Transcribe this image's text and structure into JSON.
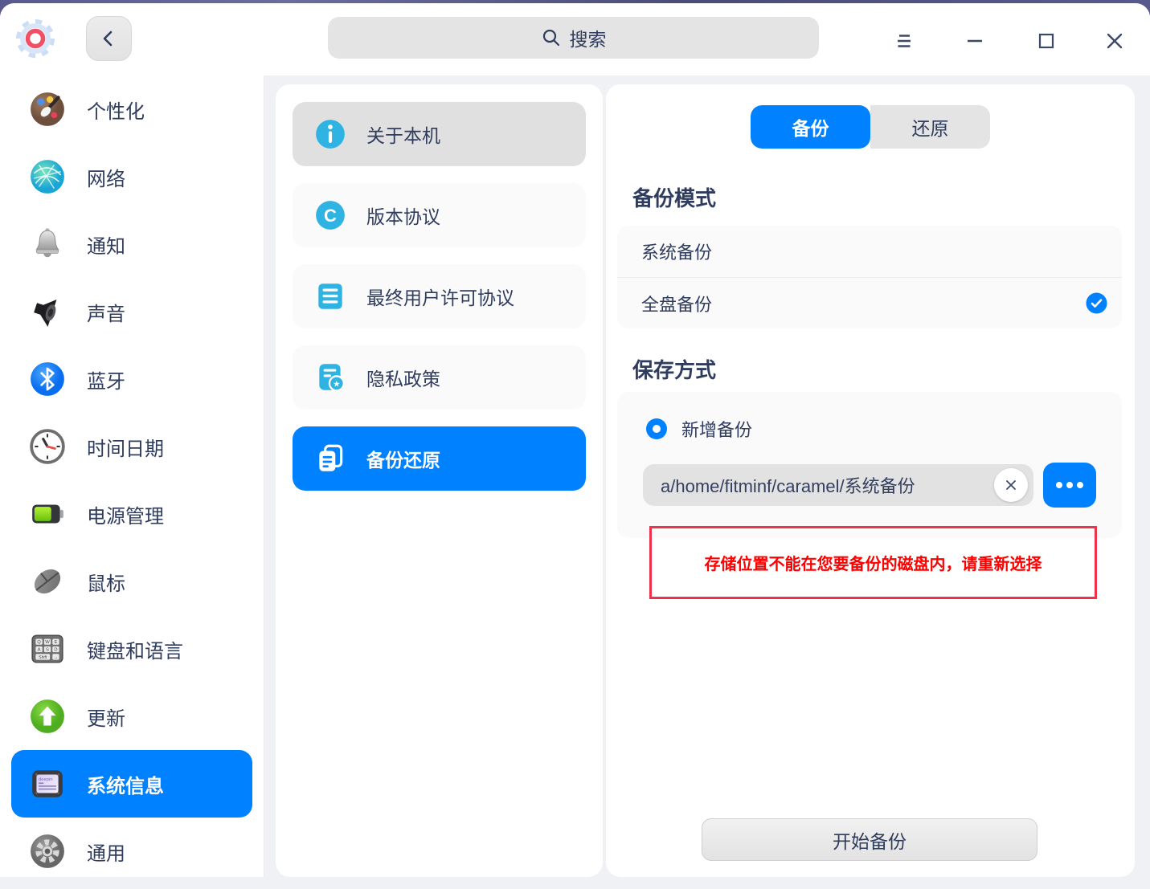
{
  "titlebar": {
    "search_placeholder": "搜索",
    "icons": [
      "app-gear-logo",
      "back-chevron",
      "search-magnifier",
      "hamburger-menu",
      "minimize",
      "maximize",
      "close"
    ]
  },
  "sidebar": {
    "items": [
      {
        "label": "个性化",
        "icon": "palette-icon",
        "selected": false
      },
      {
        "label": "网络",
        "icon": "network-globe-icon",
        "selected": false
      },
      {
        "label": "通知",
        "icon": "bell-icon",
        "selected": false
      },
      {
        "label": "声音",
        "icon": "speaker-icon",
        "selected": false
      },
      {
        "label": "蓝牙",
        "icon": "bluetooth-icon",
        "selected": false
      },
      {
        "label": "时间日期",
        "icon": "clock-icon",
        "selected": false
      },
      {
        "label": "电源管理",
        "icon": "battery-icon",
        "selected": false
      },
      {
        "label": "鼠标",
        "icon": "mouse-icon",
        "selected": false
      },
      {
        "label": "键盘和语言",
        "icon": "keyboard-icon",
        "selected": false
      },
      {
        "label": "更新",
        "icon": "update-arrow-icon",
        "selected": false
      },
      {
        "label": "系统信息",
        "icon": "deepin-chip-icon",
        "selected": true
      },
      {
        "label": "通用",
        "icon": "gear-icon",
        "selected": false
      }
    ]
  },
  "system_menu": {
    "items": [
      {
        "label": "关于本机",
        "icon": "info-icon",
        "state": "hovered"
      },
      {
        "label": "版本协议",
        "icon": "copyright-icon",
        "state": "normal"
      },
      {
        "label": "最终用户许可协议",
        "icon": "document-icon",
        "state": "normal"
      },
      {
        "label": "隐私政策",
        "icon": "privacy-star-doc-icon",
        "state": "normal"
      },
      {
        "label": "备份还原",
        "icon": "backup-docs-icon",
        "state": "selected"
      }
    ]
  },
  "backup_panel": {
    "tabs": [
      {
        "label": "备份",
        "active": true
      },
      {
        "label": "还原",
        "active": false
      }
    ],
    "mode_section": {
      "title": "备份模式",
      "options": [
        {
          "label": "系统备份",
          "checked": false
        },
        {
          "label": "全盘备份",
          "checked": true
        }
      ]
    },
    "save_section": {
      "title": "保存方式",
      "option_label": "新增备份",
      "path_value": "a/home/fitminf/caramel/系统备份"
    },
    "error_message": "存储位置不能在您要备份的磁盘内，请重新选择",
    "start_button_label": "开始备份"
  },
  "colors": {
    "accent": "#0081ff",
    "list_icon_cyan": "#2eb3e2",
    "error_text": "#fe0000",
    "error_border": "#f0314b",
    "text": "#2f3c5e"
  }
}
